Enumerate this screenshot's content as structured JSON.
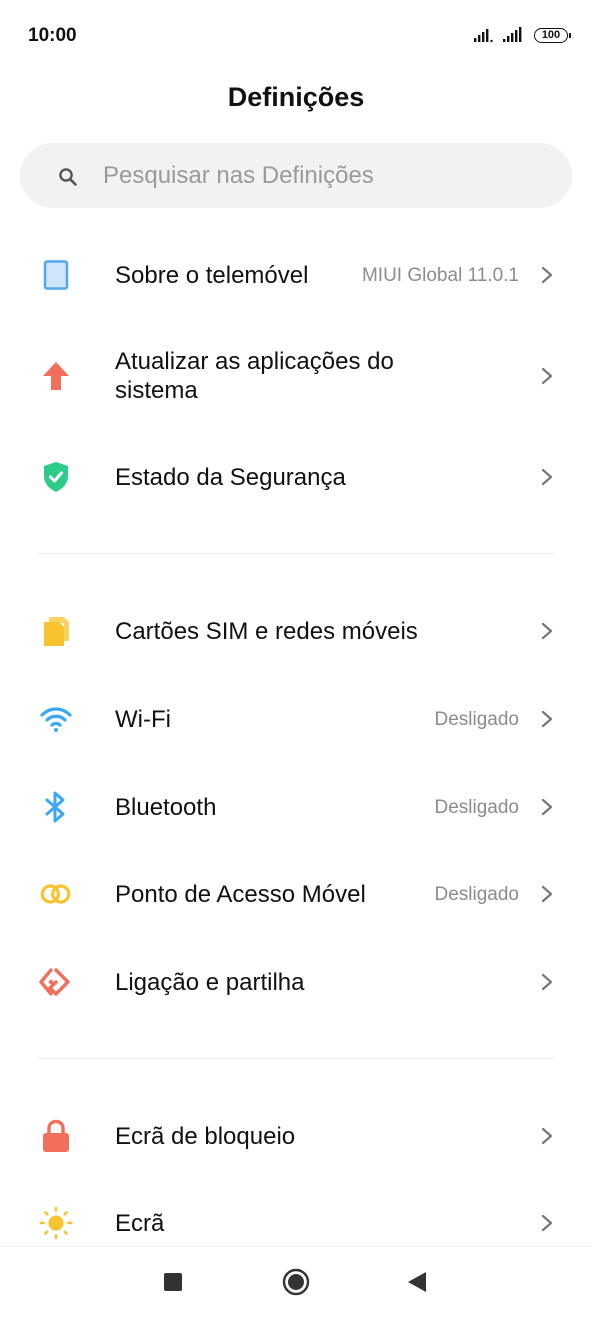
{
  "status": {
    "time": "10:00",
    "battery": "100"
  },
  "header": {
    "title": "Definições"
  },
  "search": {
    "placeholder": "Pesquisar nas Definições"
  },
  "sections": [
    {
      "items": [
        {
          "label": "Sobre o telemóvel",
          "value": "MIUI Global 11.0.1",
          "icon": "phone-icon",
          "color": "#5cb0f0"
        },
        {
          "label": "Atualizar as aplicações do sistema",
          "value": "",
          "icon": "update-arrow-icon",
          "color": "#f2705b"
        },
        {
          "label": "Estado da Segurança",
          "value": "",
          "icon": "shield-icon",
          "color": "#2ecc8a"
        }
      ]
    },
    {
      "items": [
        {
          "label": "Cartões SIM e redes móveis",
          "value": "",
          "icon": "sim-card-icon",
          "color": "#f7c32e"
        },
        {
          "label": "Wi-Fi",
          "value": "Desligado",
          "icon": "wifi-icon",
          "color": "#3aa8f2"
        },
        {
          "label": "Bluetooth",
          "value": "Desligado",
          "icon": "bluetooth-icon",
          "color": "#3aa8f2"
        },
        {
          "label": "Ponto de Acesso Móvel",
          "value": "Desligado",
          "icon": "hotspot-icon",
          "color": "#f7c32e"
        },
        {
          "label": "Ligação e partilha",
          "value": "",
          "icon": "share-icon",
          "color": "#f2705b"
        }
      ]
    },
    {
      "items": [
        {
          "label": "Ecrã de bloqueio",
          "value": "",
          "icon": "lock-icon",
          "color": "#f2705b"
        },
        {
          "label": "Ecrã",
          "value": "",
          "icon": "sun-icon",
          "color": "#f7c32e"
        }
      ]
    }
  ],
  "navbar": {
    "buttons": [
      "recents-button",
      "home-button",
      "back-button"
    ]
  }
}
